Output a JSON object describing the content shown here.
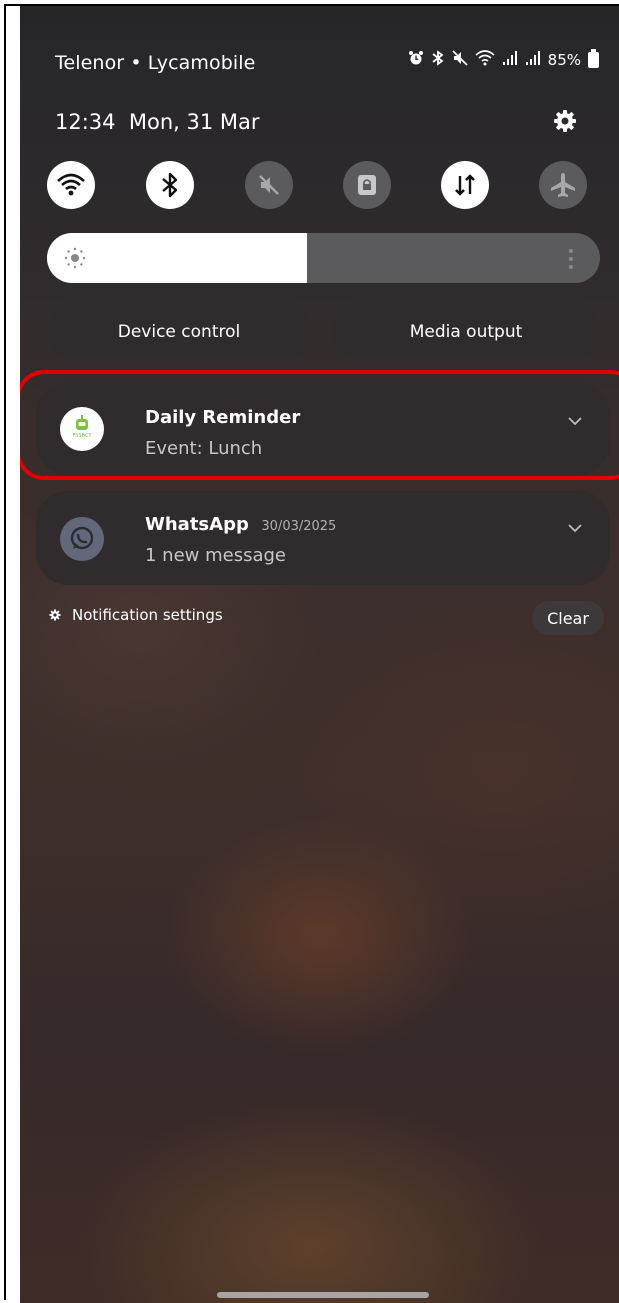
{
  "status_bar": {
    "carrier": "Telenor • Lycamobile",
    "icons": [
      "alarm-icon",
      "bluetooth-icon",
      "mute-icon",
      "wifi-icon",
      "signal-icon",
      "signal-icon"
    ],
    "battery": "85%"
  },
  "header": {
    "time": "12:34",
    "date": "Mon, 31 Mar"
  },
  "quick_settings": [
    {
      "name": "wifi",
      "icon": "wifi-icon",
      "state": "on"
    },
    {
      "name": "bluetooth",
      "icon": "bluetooth-icon",
      "state": "on"
    },
    {
      "name": "sound",
      "icon": "mute-icon",
      "state": "off"
    },
    {
      "name": "rotation-lock",
      "icon": "lock-icon",
      "state": "off"
    },
    {
      "name": "mobile-data",
      "icon": "data-arrows-icon",
      "state": "on"
    },
    {
      "name": "airplane-mode",
      "icon": "airplane-icon",
      "state": "off"
    }
  ],
  "brightness": {
    "level": 0.47
  },
  "controls": {
    "device_control": "Device control",
    "media_output": "Media output"
  },
  "notifications": [
    {
      "app": "Daily Reminder",
      "time": "",
      "body": "Event: Lunch",
      "icon": "fssbct-app-icon",
      "icon_text": "FSSBCT",
      "highlighted": true
    },
    {
      "app": "WhatsApp",
      "time": "30/03/2025",
      "body": "1 new message",
      "icon": "whatsapp-icon",
      "highlighted": false
    }
  ],
  "footer": {
    "notification_settings": "Notification settings",
    "clear": "Clear"
  },
  "colors": {
    "highlight": "#e20000",
    "tile_on": "#ffffff",
    "tile_off": "#5b5b5e"
  }
}
